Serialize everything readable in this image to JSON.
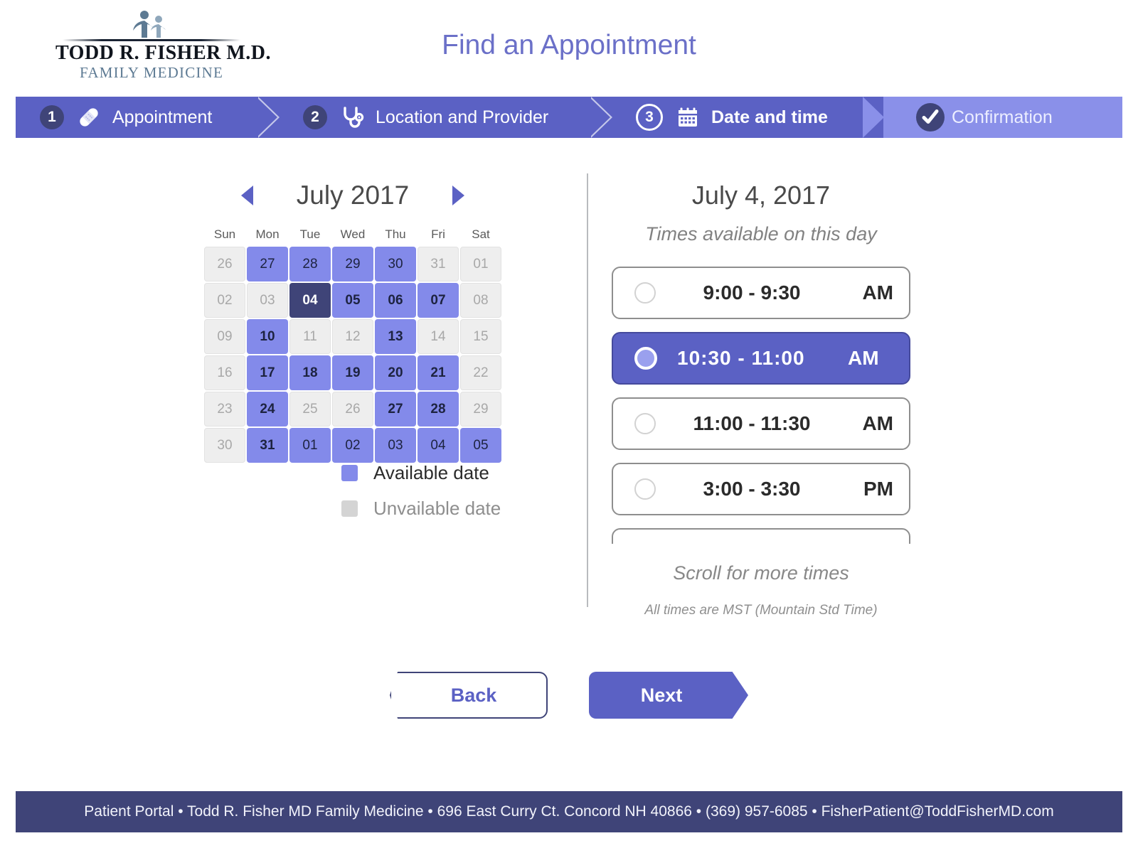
{
  "brand": {
    "logo_name": "TODD R. FISHER M.D.",
    "logo_sub": "FAMILY MEDICINE",
    "logo_icon": "family-figures-icon"
  },
  "header": {
    "title": "Find an Appointment"
  },
  "colors": {
    "accent": "#5b61c4",
    "accent_dark": "#3f4478",
    "accent_light": "#838aea",
    "step_inactive": "#8a90e9",
    "title": "#6b70c8",
    "unavailable": "#eeeeee"
  },
  "steps": [
    {
      "num": "1",
      "label": "Appointment",
      "icon": "bandage-icon",
      "state": "done"
    },
    {
      "num": "2",
      "label": "Location and Provider",
      "icon": "stethoscope-icon",
      "state": "done"
    },
    {
      "num": "3",
      "label": "Date and time",
      "icon": "calendar-icon",
      "state": "active"
    },
    {
      "num": "",
      "label": "Confirmation",
      "icon": "check-icon",
      "state": "upcoming"
    }
  ],
  "calendar": {
    "month_label": "July 2017",
    "prev_icon": "triangle-left-icon",
    "next_icon": "triangle-right-icon",
    "weekdays": [
      "Sun",
      "Mon",
      "Tue",
      "Wed",
      "Thu",
      "Fri",
      "Sat"
    ],
    "weeks": [
      [
        {
          "d": "26",
          "state": "unavailable",
          "month": "prev"
        },
        {
          "d": "27",
          "state": "available",
          "month": "prev"
        },
        {
          "d": "28",
          "state": "available",
          "month": "prev"
        },
        {
          "d": "29",
          "state": "available",
          "month": "prev"
        },
        {
          "d": "30",
          "state": "available",
          "month": "prev"
        },
        {
          "d": "31",
          "state": "unavailable",
          "month": "prev"
        },
        {
          "d": "01",
          "state": "unavailable",
          "month": "current"
        }
      ],
      [
        {
          "d": "02",
          "state": "unavailable",
          "month": "current"
        },
        {
          "d": "03",
          "state": "unavailable",
          "month": "current"
        },
        {
          "d": "04",
          "state": "selected",
          "month": "current"
        },
        {
          "d": "05",
          "state": "available",
          "month": "current"
        },
        {
          "d": "06",
          "state": "available",
          "month": "current"
        },
        {
          "d": "07",
          "state": "available",
          "month": "current"
        },
        {
          "d": "08",
          "state": "unavailable",
          "month": "current"
        }
      ],
      [
        {
          "d": "09",
          "state": "unavailable",
          "month": "current"
        },
        {
          "d": "10",
          "state": "available",
          "month": "current"
        },
        {
          "d": "11",
          "state": "unavailable",
          "month": "current"
        },
        {
          "d": "12",
          "state": "unavailable",
          "month": "current"
        },
        {
          "d": "13",
          "state": "available",
          "month": "current"
        },
        {
          "d": "14",
          "state": "unavailable",
          "month": "current"
        },
        {
          "d": "15",
          "state": "unavailable",
          "month": "current"
        }
      ],
      [
        {
          "d": "16",
          "state": "unavailable",
          "month": "current"
        },
        {
          "d": "17",
          "state": "available",
          "month": "current"
        },
        {
          "d": "18",
          "state": "available",
          "month": "current"
        },
        {
          "d": "19",
          "state": "available",
          "month": "current"
        },
        {
          "d": "20",
          "state": "available",
          "month": "current"
        },
        {
          "d": "21",
          "state": "available",
          "month": "current"
        },
        {
          "d": "22",
          "state": "unavailable",
          "month": "current"
        }
      ],
      [
        {
          "d": "23",
          "state": "unavailable",
          "month": "current"
        },
        {
          "d": "24",
          "state": "available",
          "month": "current"
        },
        {
          "d": "25",
          "state": "unavailable",
          "month": "current"
        },
        {
          "d": "26",
          "state": "unavailable",
          "month": "current"
        },
        {
          "d": "27",
          "state": "available",
          "month": "current"
        },
        {
          "d": "28",
          "state": "available",
          "month": "current"
        },
        {
          "d": "29",
          "state": "unavailable",
          "month": "current"
        }
      ],
      [
        {
          "d": "30",
          "state": "unavailable",
          "month": "current"
        },
        {
          "d": "31",
          "state": "available",
          "month": "current"
        },
        {
          "d": "01",
          "state": "available",
          "month": "next"
        },
        {
          "d": "02",
          "state": "available",
          "month": "next"
        },
        {
          "d": "03",
          "state": "available",
          "month": "next"
        },
        {
          "d": "04",
          "state": "available",
          "month": "next"
        },
        {
          "d": "05",
          "state": "available",
          "month": "next"
        }
      ]
    ],
    "legend": [
      {
        "label": "Available date",
        "state": "available"
      },
      {
        "label": "Unvailable date",
        "state": "unavailable"
      }
    ]
  },
  "times_panel": {
    "date": "July 4, 2017",
    "subtitle": "Times available on this day",
    "slots": [
      {
        "range": "9:00 - 9:30",
        "meridiem": "AM",
        "selected": false
      },
      {
        "range": "10:30  -  11:00",
        "meridiem": "AM",
        "selected": true
      },
      {
        "range": "11:00 - 11:30",
        "meridiem": "AM",
        "selected": false
      },
      {
        "range": "3:00 - 3:30",
        "meridiem": "PM",
        "selected": false
      },
      {
        "range": "",
        "meridiem": "",
        "selected": false
      }
    ],
    "scroll_hint": "Scroll for more times",
    "timezone_note": "All times are MST (Mountain Std Time)"
  },
  "nav": {
    "back_label": "Back",
    "next_label": "Next"
  },
  "footer": {
    "text": "Patient Portal • Todd R. Fisher MD Family Medicine •  696 East Curry Ct. Concord NH 40866  •  (369) 957-6085  •  FisherPatient@ToddFisherMD.com"
  }
}
